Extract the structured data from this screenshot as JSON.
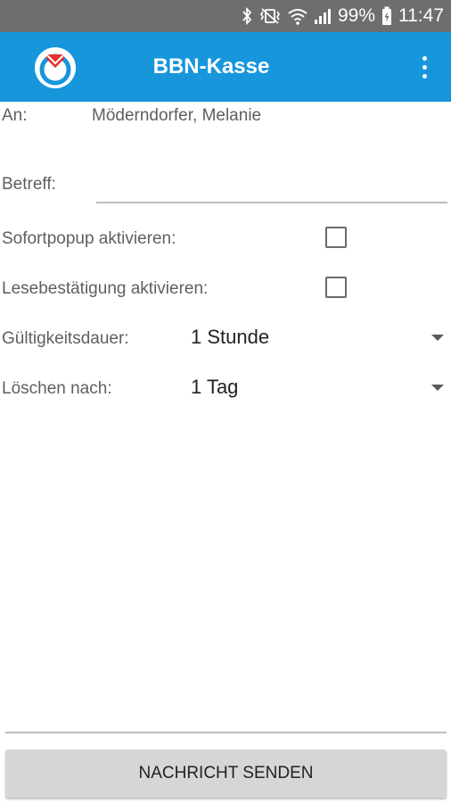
{
  "status_bar": {
    "battery": "99%",
    "time": "11:47",
    "icons": [
      "bluetooth-icon",
      "vibrate-icon",
      "wifi-icon",
      "signal-icon",
      "battery-charging-icon"
    ]
  },
  "app_bar": {
    "title": "BBN-Kasse",
    "logo_icon": "app-logo-icon",
    "menu_icon": "overflow-menu-icon",
    "color": "#1796dc"
  },
  "form": {
    "to": {
      "label": "An:",
      "value": "Möderndorfer, Melanie"
    },
    "subject": {
      "label": "Betreff:",
      "value": "",
      "placeholder": ""
    },
    "instant_popup": {
      "label": "Sofortpopup aktivieren:",
      "checked": false
    },
    "read_receipt": {
      "label": "Lesebestätigung aktivieren:",
      "checked": false
    },
    "validity": {
      "label": "Gültigkeitsdauer:",
      "selected": "1 Stunde"
    },
    "delete_after": {
      "label": "Löschen nach:",
      "selected": "1 Tag"
    }
  },
  "actions": {
    "send_label": "NACHRICHT SENDEN"
  }
}
